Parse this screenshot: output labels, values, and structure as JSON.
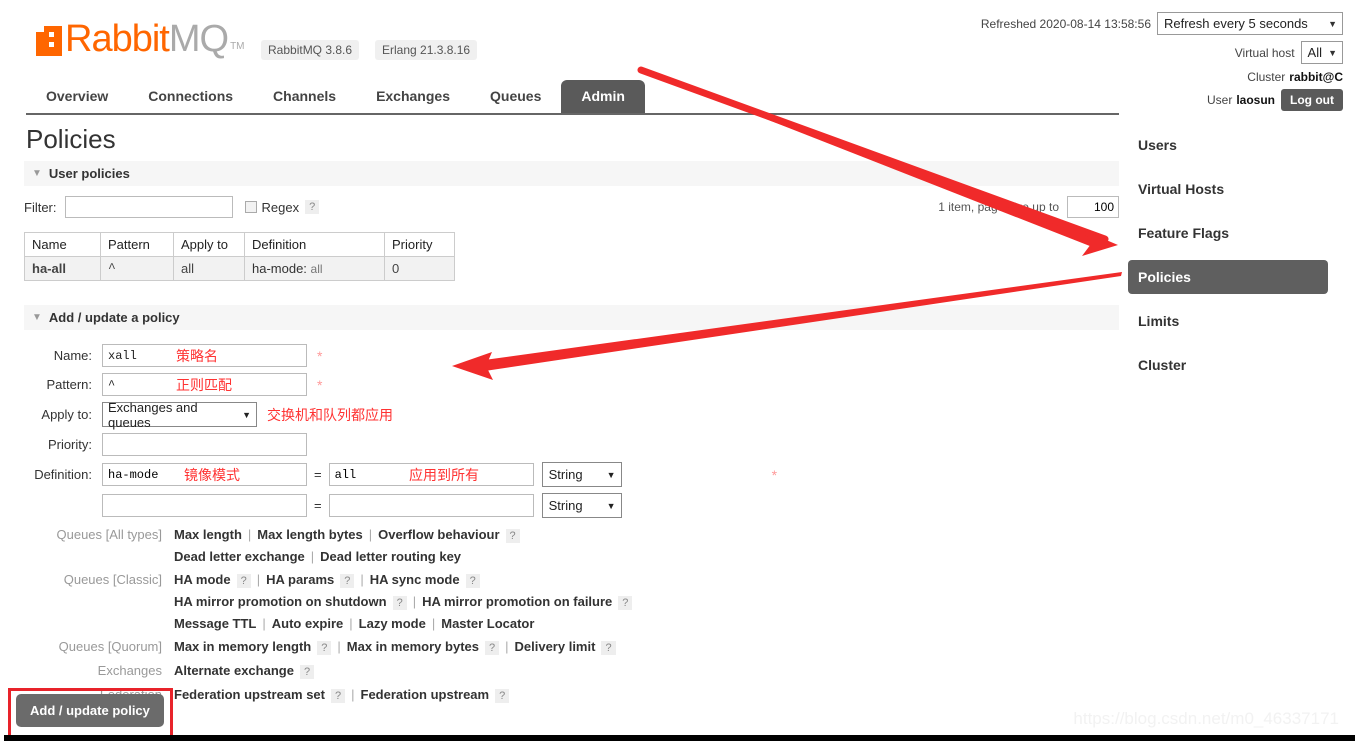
{
  "header": {
    "logo_rabbit": "Rabbit",
    "logo_mq": "MQ",
    "logo_tm": "TM",
    "version_badge": "RabbitMQ 3.8.6",
    "erlang_badge": "Erlang 21.3.8.16",
    "refreshed_text": "Refreshed 2020-08-14 13:58:56",
    "refresh_select": "Refresh every 5 seconds",
    "vhost_label": "Virtual host",
    "vhost_select": "All",
    "cluster_label": "Cluster",
    "cluster_value": "rabbit@C",
    "user_label": "User",
    "user_value": "laosun",
    "logout_label": "Log out",
    "caret": "▼"
  },
  "tabs": [
    {
      "label": "Overview",
      "active": false
    },
    {
      "label": "Connections",
      "active": false
    },
    {
      "label": "Channels",
      "active": false
    },
    {
      "label": "Exchanges",
      "active": false
    },
    {
      "label": "Queues",
      "active": false
    },
    {
      "label": "Admin",
      "active": true
    }
  ],
  "page": {
    "title": "Policies"
  },
  "user_policies": {
    "section_label": "User policies",
    "triangle": "▼",
    "filter_label": "Filter:",
    "filter_value": "",
    "regex_label": "Regex",
    "help": "?",
    "paging_text": "1 item, page size up to",
    "page_size": "100",
    "columns": [
      "Name",
      "Pattern",
      "Apply to",
      "Definition",
      "Priority"
    ],
    "rows": [
      {
        "name": "ha-all",
        "pattern": "^",
        "apply_to": "all",
        "definition_key": "ha-mode:",
        "definition_value": "all",
        "priority": "0"
      }
    ]
  },
  "add_policy": {
    "section_label": "Add / update a policy",
    "triangle": "▼",
    "fields": {
      "name_label": "Name:",
      "name_value": "xall",
      "name_annotation": "策略名",
      "pattern_label": "Pattern:",
      "pattern_value": "^",
      "pattern_annotation": "正则匹配",
      "apply_to_label": "Apply to:",
      "apply_to_value": "Exchanges and queues",
      "apply_to_annotation": "交换机和队列都应用",
      "priority_label": "Priority:",
      "priority_value": "",
      "definition_label": "Definition:",
      "def_key_1": "ha-mode",
      "def_key_1_annotation": "镜像模式",
      "def_value_1": "all",
      "def_value_1_annotation": "应用到所有",
      "def_type_1": "String",
      "def_key_2": "",
      "def_value_2": "",
      "def_type_2": "String",
      "equals": "=",
      "required_mark": "*",
      "caret": "▼"
    },
    "hint_groups": [
      {
        "label": "Queues [All types]",
        "lines": [
          [
            {
              "text": "Max length",
              "help": false
            },
            {
              "text": "Max length bytes",
              "help": false
            },
            {
              "text": "Overflow behaviour",
              "help": true
            }
          ],
          [
            {
              "text": "Dead letter exchange",
              "help": false
            },
            {
              "text": "Dead letter routing key",
              "help": false
            }
          ]
        ]
      },
      {
        "label": "Queues [Classic]",
        "lines": [
          [
            {
              "text": "HA mode",
              "help": true
            },
            {
              "text": "HA params",
              "help": true
            },
            {
              "text": "HA sync mode",
              "help": true
            }
          ],
          [
            {
              "text": "HA mirror promotion on shutdown",
              "help": true
            },
            {
              "text": "HA mirror promotion on failure",
              "help": true
            }
          ],
          [
            {
              "text": "Message TTL",
              "help": false
            },
            {
              "text": "Auto expire",
              "help": false
            },
            {
              "text": "Lazy mode",
              "help": false
            },
            {
              "text": "Master Locator",
              "help": false
            }
          ]
        ]
      },
      {
        "label": "Queues [Quorum]",
        "lines": [
          [
            {
              "text": "Max in memory length",
              "help": true
            },
            {
              "text": "Max in memory bytes",
              "help": true
            },
            {
              "text": "Delivery limit",
              "help": true
            }
          ]
        ]
      },
      {
        "label": "Exchanges",
        "lines": [
          [
            {
              "text": "Alternate exchange",
              "help": true
            }
          ]
        ]
      },
      {
        "label": "Federation",
        "lines": [
          [
            {
              "text": "Federation upstream set",
              "help": true
            },
            {
              "text": "Federation upstream",
              "help": true
            }
          ]
        ]
      }
    ],
    "submit_label": "Add / update policy"
  },
  "right_nav": [
    {
      "label": "Users",
      "active": false
    },
    {
      "label": "Virtual Hosts",
      "active": false
    },
    {
      "label": "Feature Flags",
      "active": false
    },
    {
      "label": "Policies",
      "active": true
    },
    {
      "label": "Limits",
      "active": false
    },
    {
      "label": "Cluster",
      "active": false
    }
  ],
  "watermark": "https://blog.csdn.net/m0_46337171",
  "colors": {
    "brand_orange": "#f60",
    "annotation_red": "#f33",
    "arrow_red": "#f02a2a",
    "highlight_box": "#e8232a",
    "active_nav": "#5f5f5f"
  }
}
